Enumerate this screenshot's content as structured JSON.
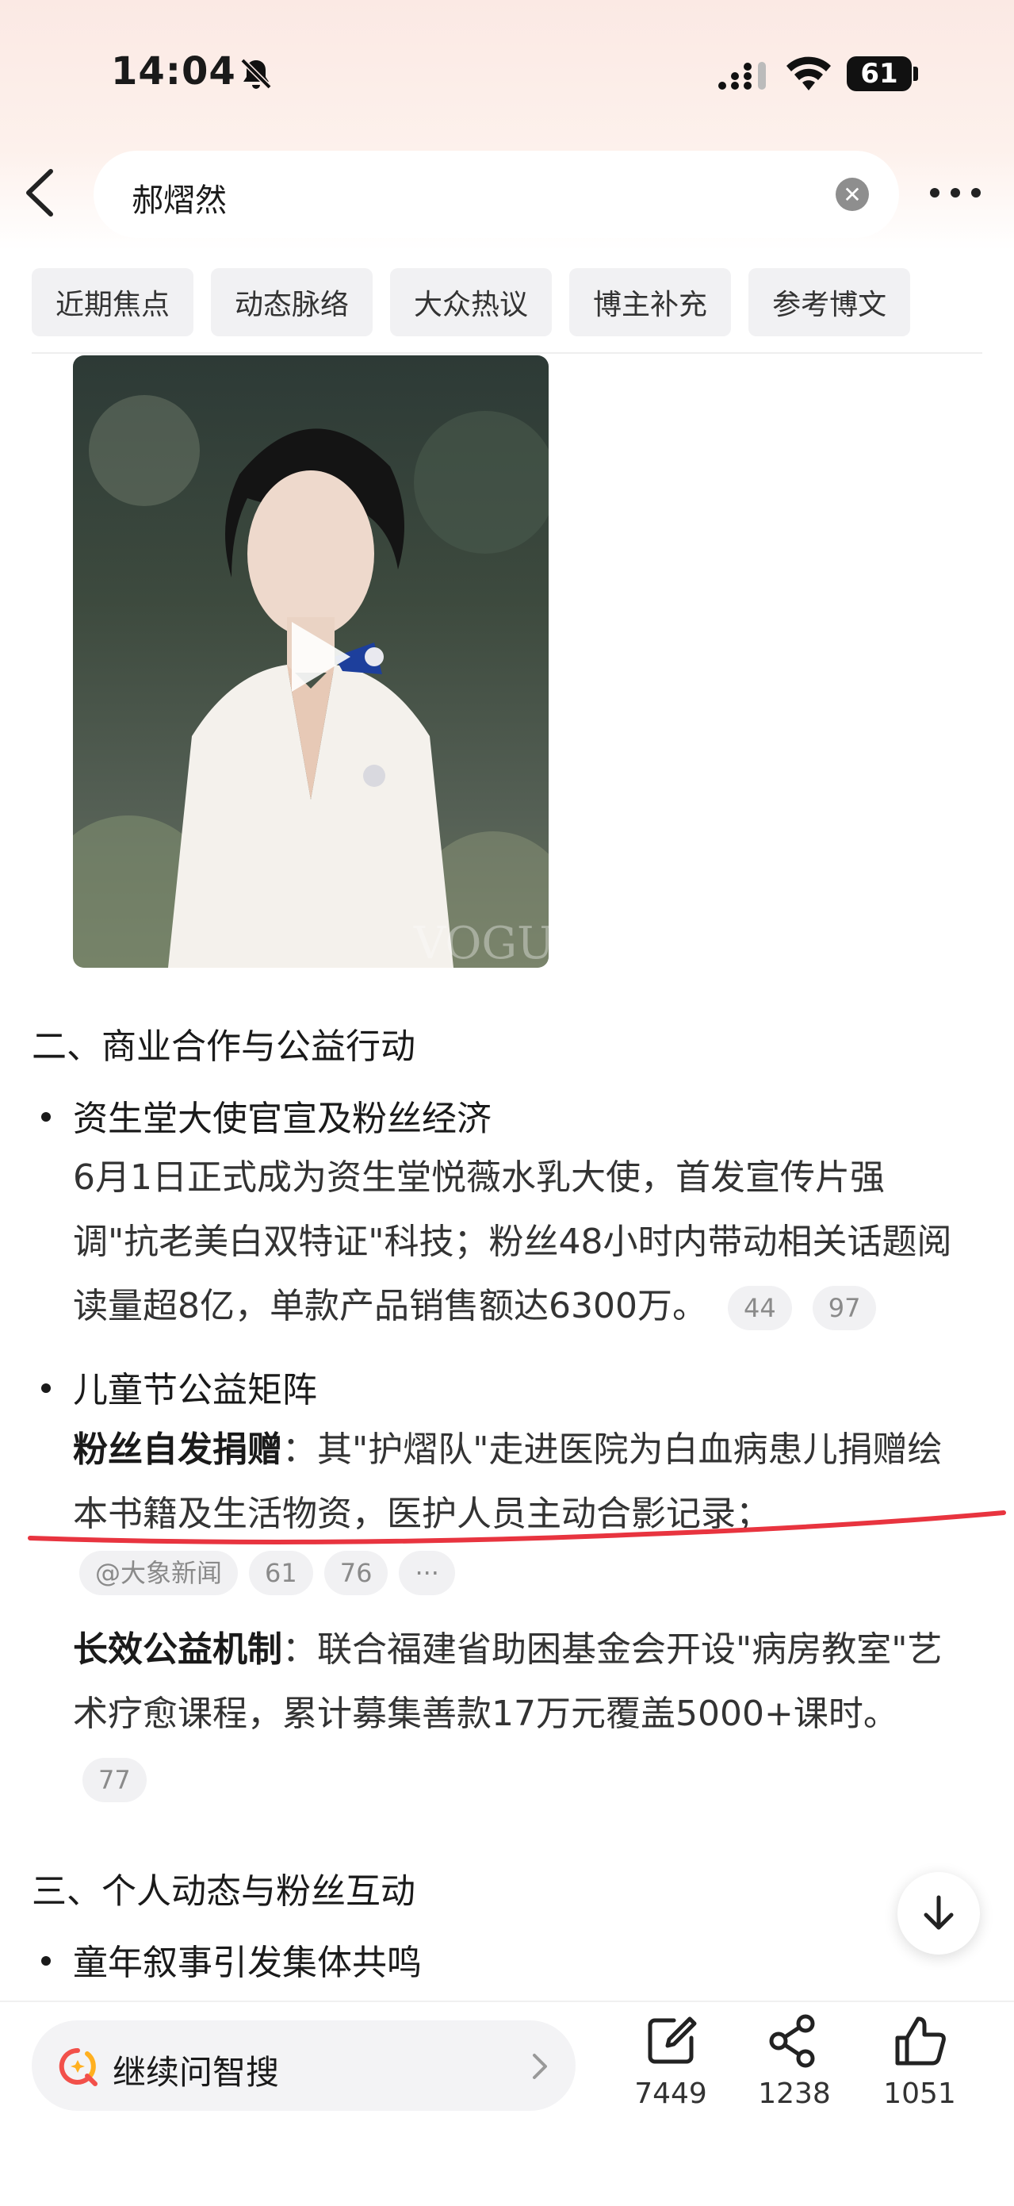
{
  "status_bar": {
    "time": "14:04",
    "battery": "61"
  },
  "search": {
    "query": "郝熠然"
  },
  "tabs": [
    {
      "label": "近期焦点"
    },
    {
      "label": "动态脉络"
    },
    {
      "label": "大众热议"
    },
    {
      "label": "博主补充"
    },
    {
      "label": "参考博文"
    }
  ],
  "video": {
    "watermark": "VOGUE"
  },
  "article": {
    "section2_title": "二、商业合作与公益行动",
    "item1_title": "资生堂大使官宣及粉丝经济",
    "item1_text": "6月1日正式成为资生堂悦薇水乳大使，首发宣传片强调\"抗老美白双特证\"科技；粉丝48小时内带动相关话题阅读量超8亿，单款产品销售额达6300万。",
    "item1_pills": [
      "44",
      "97"
    ],
    "item2_title": "儿童节公益矩阵",
    "item2_p1_label": "粉丝自发捐赠",
    "item2_p1_text": "：其\"护熠队\"走进医院为白血病患儿捐赠绘本书籍及生活物资，医护人员主动合影记录；",
    "item2_p1_source": "@大象新闻",
    "item2_p1_pills": [
      "61",
      "76",
      "···"
    ],
    "item2_p2_label": "长效公益机制",
    "item2_p2_text": "：联合福建省助困基金会开设\"病房教室\"艺术疗愈课程，累计募集善款17万元覆盖5000+课时。",
    "item2_p2_pills": [
      "77"
    ],
    "section3_title": "三、个人动态与粉丝互动",
    "item3_title": "童年叙事引发集体共鸣"
  },
  "bottom_bar": {
    "ask_label": "继续问智搜",
    "edit_count": "7449",
    "share_count": "1238",
    "like_count": "1051"
  },
  "colors": {
    "header_tint": "#fbe9e4",
    "annotation_red": "#e8343f",
    "ask_accent_red": "#f2504a",
    "ask_accent_orange": "#ffb020"
  }
}
